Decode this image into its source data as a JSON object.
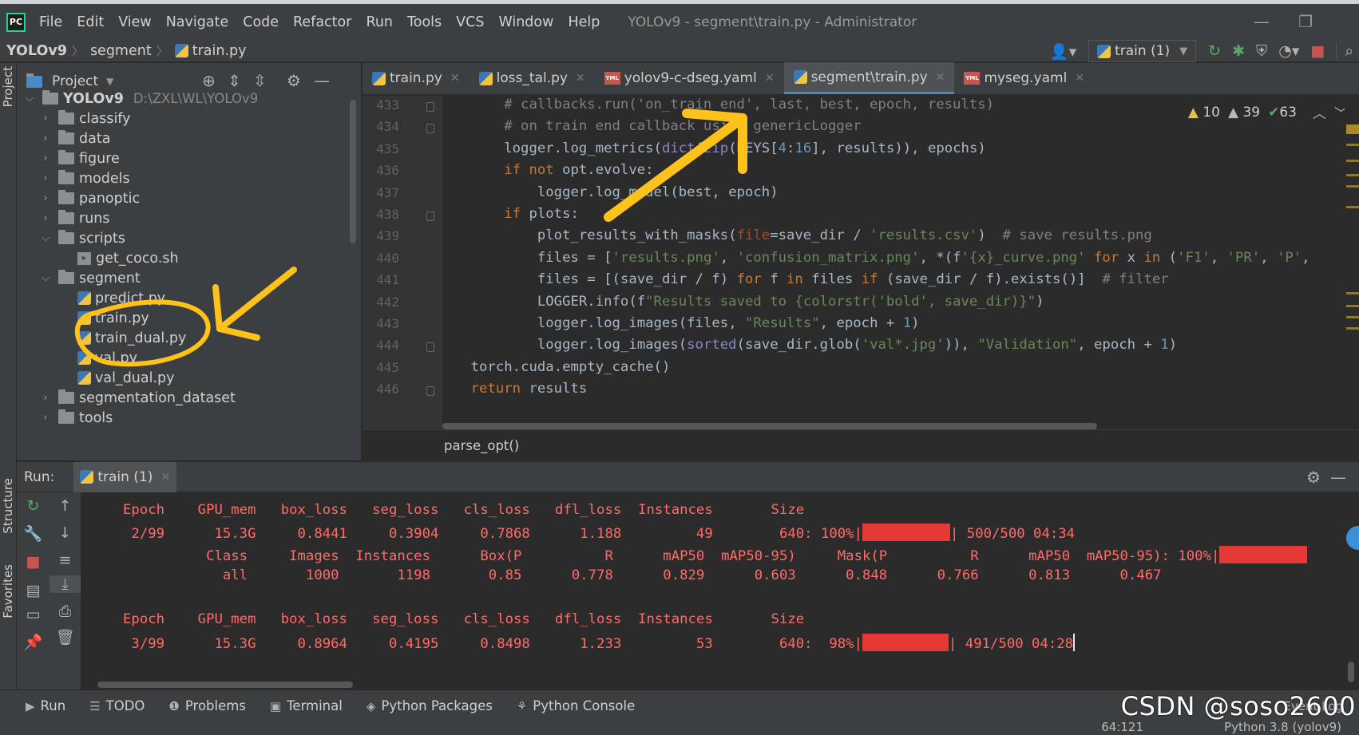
{
  "menu": {
    "items": [
      "File",
      "Edit",
      "View",
      "Navigate",
      "Code",
      "Refactor",
      "Run",
      "Tools",
      "VCS",
      "Window",
      "Help"
    ],
    "window_title": "YOLOv9 - segment\\train.py - Administrator"
  },
  "navbar": {
    "project": "YOLOv9",
    "folder": "segment",
    "file": "train.py",
    "run_config": "train (1)"
  },
  "project_panel": {
    "title": "Project",
    "root_name": "YOLOv9",
    "root_path": "D:\\ZXL\\WL\\YOLOv9",
    "items": [
      {
        "label": "classify",
        "kind": "folder",
        "expanded": false
      },
      {
        "label": "data",
        "kind": "folder",
        "expanded": false
      },
      {
        "label": "figure",
        "kind": "folder",
        "expanded": false
      },
      {
        "label": "models",
        "kind": "folder",
        "expanded": false
      },
      {
        "label": "panoptic",
        "kind": "folder",
        "expanded": false
      },
      {
        "label": "runs",
        "kind": "folder",
        "expanded": false
      },
      {
        "label": "scripts",
        "kind": "folder",
        "expanded": true
      },
      {
        "label": "get_coco.sh",
        "kind": "sh"
      },
      {
        "label": "segment",
        "kind": "folder",
        "expanded": true
      },
      {
        "label": "predict.py",
        "kind": "py"
      },
      {
        "label": "train.py",
        "kind": "py"
      },
      {
        "label": "train_dual.py",
        "kind": "py"
      },
      {
        "label": "val.py",
        "kind": "py"
      },
      {
        "label": "val_dual.py",
        "kind": "py"
      },
      {
        "label": "segmentation_dataset",
        "kind": "folder",
        "expanded": false
      },
      {
        "label": "tools",
        "kind": "folder",
        "expanded": false
      }
    ]
  },
  "editor_tabs": [
    {
      "label": "train.py",
      "kind": "py",
      "active": false
    },
    {
      "label": "loss_tal.py",
      "kind": "py",
      "active": false
    },
    {
      "label": "yolov9-c-dseg.yaml",
      "kind": "yml",
      "active": false
    },
    {
      "label": "segment\\train.py",
      "kind": "py",
      "active": true
    },
    {
      "label": "myseg.yaml",
      "kind": "yml",
      "active": false
    }
  ],
  "inspections": {
    "warnings_a": "10",
    "warnings_b": "39",
    "ok": "63"
  },
  "code": {
    "line_numbers": [
      "433",
      "434",
      "435",
      "436",
      "437",
      "438",
      "439",
      "440",
      "441",
      "442",
      "443",
      "444",
      "445",
      "446"
    ],
    "lines": [
      "        # callbacks.run('on_train_end', last, best, epoch, results)",
      "        # on train end callback using genericLogger",
      "        logger.log_metrics(dict(zip(KEYS[4:16], results)), epochs)",
      "        if not opt.evolve:",
      "            logger.log_model(best, epoch)",
      "        if plots:",
      "            plot_results_with_masks(file=save_dir / 'results.csv')  # save results.png",
      "            files = ['results.png', 'confusion_matrix.png', *(f'{x}_curve.png' for x in ('F1', 'PR', 'P',",
      "            files = [(save_dir / f) for f in files if (save_dir / f).exists()]  # filter",
      "            LOGGER.info(f\"Results saved to {colorstr('bold', save_dir)}\")",
      "            logger.log_images(files, \"Results\", epoch + 1)",
      "            logger.log_images(sorted(save_dir.glob('val*.jpg')), \"Validation\", epoch + 1)",
      "    torch.cuda.empty_cache()",
      "    return results"
    ]
  },
  "breadcrumb": "parse_opt()",
  "run_panel": {
    "label": "Run:",
    "tab": "train (1)",
    "console_lines": [
      "     Epoch    GPU_mem   box_loss   seg_loss   cls_loss   dfl_loss  Instances       Size",
      "      2/99      15.3G     0.8441     0.3904     0.7868      1.188         49        640: 100%|",
      "| 500/500 04:34",
      "               Class     Images  Instances      Box(P          R      mAP50  mAP50-95)     Mask(P          R      mAP50  mAP50-95): 100%|",
      "                 all       1000       1198       0.85      0.778      0.829      0.603      0.848      0.766      0.813      0.467",
      "     Epoch    GPU_mem   box_loss   seg_loss   cls_loss   dfl_loss  Instances       Size",
      "      3/99      15.3G     0.8964     0.4195     0.8498      1.233         53        640:  98%|",
      "| 491/500 04:28"
    ],
    "progress": {
      "epoch2_train": 1.0,
      "epoch2_val": 1.0,
      "epoch3_train": 0.98
    }
  },
  "left_strip": {
    "project": "Project",
    "structure": "Structure",
    "favorites": "Favorites"
  },
  "bottom_tabs": [
    "Run",
    "TODO",
    "Problems",
    "Terminal",
    "Python Packages",
    "Python Console"
  ],
  "event_log": "Event Log",
  "status": {
    "position": "64:121",
    "interpreter": "Python 3.8 (yolov9)"
  },
  "watermark": "CSDN @soso2600",
  "colors": {
    "annotation": "#ffc21a",
    "console_text": "#ff6b68",
    "progress_bar": "#e53935",
    "accent": "#4a88c7"
  }
}
